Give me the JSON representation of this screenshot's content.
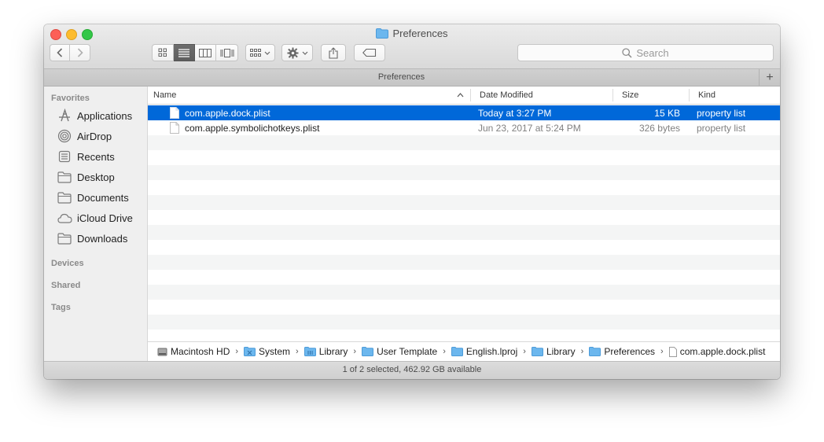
{
  "window": {
    "title": "Preferences",
    "tab_title": "Preferences",
    "tab_add_label": "+"
  },
  "toolbar": {
    "search_placeholder": "Search",
    "view_modes": [
      "icon-view",
      "list-view",
      "column-view",
      "cover-flow-view"
    ],
    "active_view": "list-view"
  },
  "sidebar": {
    "favorites_label": "Favorites",
    "favorites": [
      {
        "label": "Applications",
        "icon": "applications-icon"
      },
      {
        "label": "AirDrop",
        "icon": "airdrop-icon"
      },
      {
        "label": "Recents",
        "icon": "recents-icon"
      },
      {
        "label": "Desktop",
        "icon": "folder-icon"
      },
      {
        "label": "Documents",
        "icon": "folder-icon"
      },
      {
        "label": "iCloud Drive",
        "icon": "cloud-icon"
      },
      {
        "label": "Downloads",
        "icon": "folder-icon"
      }
    ],
    "devices_label": "Devices",
    "shared_label": "Shared",
    "tags_label": "Tags"
  },
  "columns": {
    "name": "Name",
    "date": "Date Modified",
    "size": "Size",
    "kind": "Kind"
  },
  "files": [
    {
      "name": "com.apple.dock.plist",
      "date": "Today at 3:27 PM",
      "size": "15 KB",
      "kind": "property list",
      "selected": true
    },
    {
      "name": "com.apple.symbolichotkeys.plist",
      "date": "Jun 23, 2017 at 5:24 PM",
      "size": "326 bytes",
      "kind": "property list",
      "selected": false
    }
  ],
  "path": [
    {
      "label": "Macintosh HD",
      "icon": "hard-drive-icon"
    },
    {
      "label": "System",
      "icon": "system-folder-icon"
    },
    {
      "label": "Library",
      "icon": "library-folder-icon"
    },
    {
      "label": "User Template",
      "icon": "folder-icon"
    },
    {
      "label": "English.lproj",
      "icon": "folder-icon"
    },
    {
      "label": "Library",
      "icon": "folder-icon"
    },
    {
      "label": "Preferences",
      "icon": "folder-icon"
    },
    {
      "label": "com.apple.dock.plist",
      "icon": "file-icon"
    }
  ],
  "status": "1 of 2 selected, 462.92 GB available",
  "colors": {
    "selection": "#0068d9",
    "folder": "#6cb7ee",
    "close": "#fc5f57",
    "minimize": "#fdbc2e",
    "maximize": "#33c748"
  }
}
